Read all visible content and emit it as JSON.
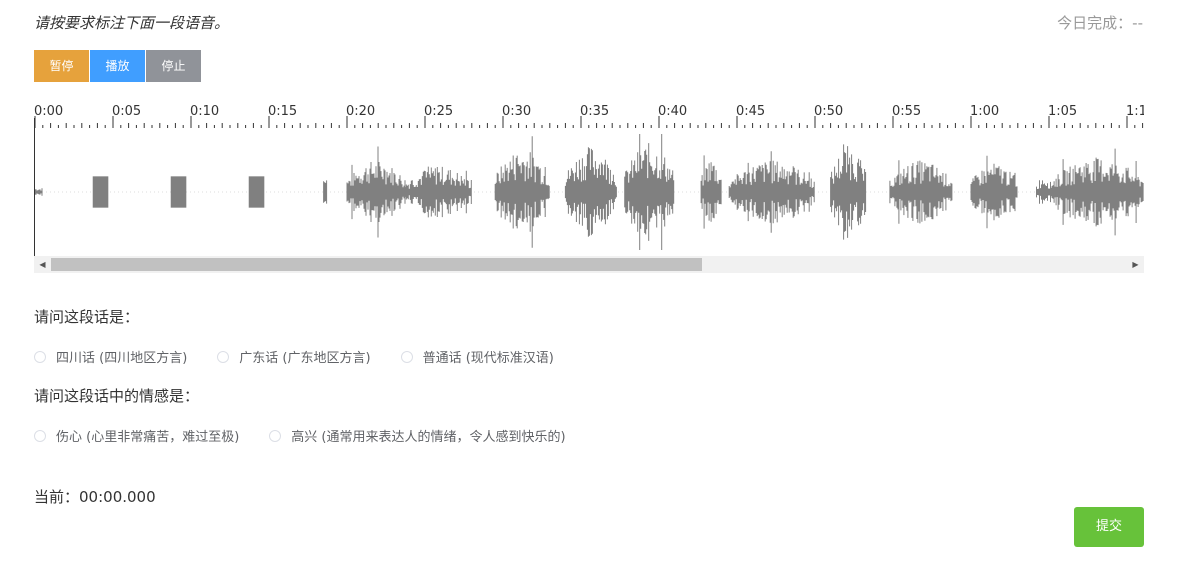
{
  "header": {
    "instruction": "请按要求标注下面一段语音。",
    "progress_label": "今日完成：",
    "progress_value": "--"
  },
  "controls": {
    "pause_label": "暂停",
    "play_label": "播放",
    "stop_label": "停止",
    "colors": {
      "pause": "#e6a23c",
      "play": "#409eff",
      "stop": "#909399"
    }
  },
  "timeline": {
    "labels": [
      "0:00",
      "0:05",
      "0:10",
      "0:15",
      "0:20",
      "0:25",
      "0:30",
      "0:35",
      "0:40",
      "0:45",
      "0:50",
      "0:55",
      "1:00",
      "1:05",
      "1:1"
    ]
  },
  "waveform": {
    "color": "#808080",
    "segments": [
      {
        "start": 0.0,
        "end": 0.5,
        "amp": 0.05,
        "type": "line"
      },
      {
        "start": 3.7,
        "end": 4.7,
        "amp": 0.27,
        "type": "block"
      },
      {
        "start": 8.7,
        "end": 9.7,
        "amp": 0.27,
        "type": "block"
      },
      {
        "start": 13.7,
        "end": 14.7,
        "amp": 0.27,
        "type": "block"
      },
      {
        "start": 18.5,
        "end": 18.7,
        "amp": 0.22,
        "type": "spike"
      },
      {
        "start": 20.0,
        "end": 23.8,
        "amp": 0.55,
        "type": "speech"
      },
      {
        "start": 23.8,
        "end": 28.0,
        "amp": 0.45,
        "type": "speech"
      },
      {
        "start": 29.5,
        "end": 33.0,
        "amp": 0.75,
        "type": "speech"
      },
      {
        "start": 34.0,
        "end": 37.3,
        "amp": 0.8,
        "type": "speech"
      },
      {
        "start": 37.8,
        "end": 41.0,
        "amp": 0.85,
        "type": "speech"
      },
      {
        "start": 42.7,
        "end": 44.0,
        "amp": 0.6,
        "type": "speech"
      },
      {
        "start": 44.5,
        "end": 50.0,
        "amp": 0.55,
        "type": "speech"
      },
      {
        "start": 51.0,
        "end": 53.3,
        "amp": 0.8,
        "type": "speech"
      },
      {
        "start": 54.8,
        "end": 58.8,
        "amp": 0.55,
        "type": "speech"
      },
      {
        "start": 60.0,
        "end": 63.0,
        "amp": 0.5,
        "type": "speech"
      },
      {
        "start": 64.2,
        "end": 65.2,
        "amp": 0.3,
        "type": "speech"
      },
      {
        "start": 65.2,
        "end": 71.5,
        "amp": 0.6,
        "type": "speech"
      }
    ]
  },
  "question1": {
    "text": "请问这段话是：",
    "options": [
      "四川话 (四川地区方言)",
      "广东话 (广东地区方言)",
      "普通话 (现代标准汉语)"
    ]
  },
  "question2": {
    "text": "请问这段话中的情感是：",
    "options": [
      "伤心 (心里非常痛苦，难过至极)",
      "高兴 (通常用来表达人的情绪，令人感到快乐的)"
    ]
  },
  "current": {
    "label": "当前：",
    "value": "00:00.000"
  },
  "submit_label": "提交"
}
